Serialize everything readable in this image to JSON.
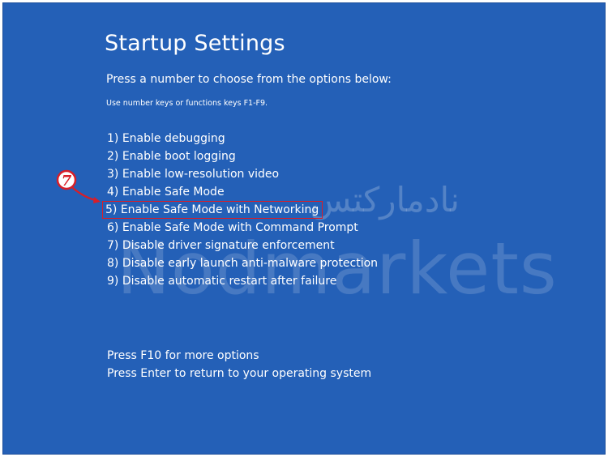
{
  "screen": {
    "title": "Startup Settings",
    "subtitle": "Press a number to choose from the options below:",
    "hint": "Use number keys or functions keys F1-F9."
  },
  "options": [
    {
      "label": "1) Enable debugging"
    },
    {
      "label": "2) Enable boot logging"
    },
    {
      "label": "3) Enable low-resolution video"
    },
    {
      "label": "4) Enable Safe Mode"
    },
    {
      "label": "5) Enable Safe Mode with Networking"
    },
    {
      "label": "6) Enable Safe Mode with Command Prompt"
    },
    {
      "label": "7) Disable driver signature enforcement"
    },
    {
      "label": "8) Disable early launch anti-malware protection"
    },
    {
      "label": "9) Disable automatic restart after failure"
    }
  ],
  "highlighted_option_index": 4,
  "footer": {
    "more_options": "Press F10 for more options",
    "return": "Press Enter to return to your operating system"
  },
  "annotation": {
    "step_number": "7",
    "color": "#d81e28"
  },
  "watermark": {
    "persian": "نادمارکتس",
    "latin": "Nodmarkets"
  },
  "colors": {
    "background": "#2460b7",
    "text": "#ffffff",
    "highlight_border": "#d81e28"
  }
}
